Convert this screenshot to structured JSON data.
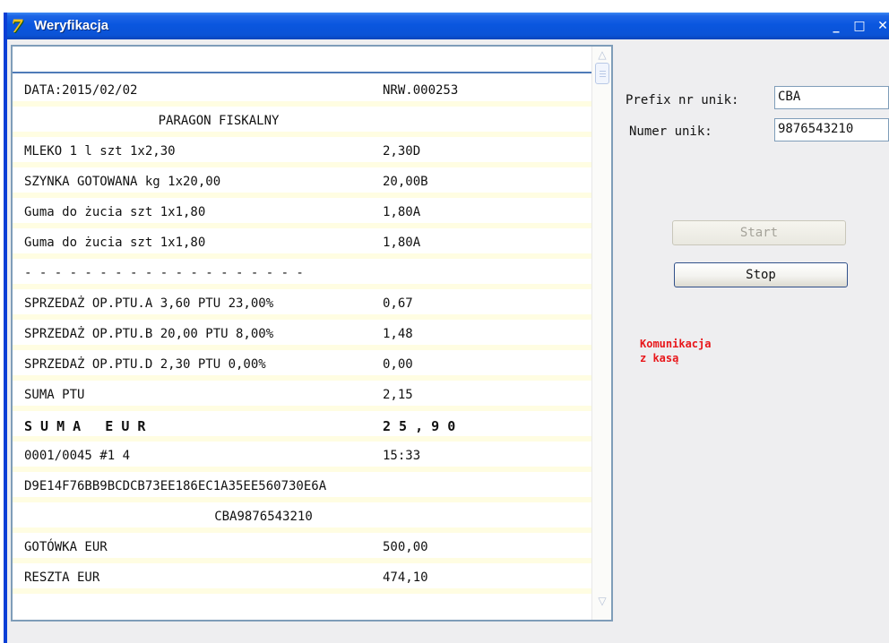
{
  "window": {
    "title": "Weryfikacja",
    "icon": "7"
  },
  "controls": {
    "minimize": "_",
    "maximize": "□",
    "close": "✕"
  },
  "receipt": {
    "lines": [
      {
        "left": "DATA:2015/02/02",
        "right": "NRW.000253"
      },
      {
        "center": "PARAGON FISKALNY"
      },
      {
        "left": "MLEKO 1 l szt 1x2,30",
        "right": "2,30D"
      },
      {
        "left": "SZYNKA GOTOWANA kg 1x20,00",
        "right": "20,00B"
      },
      {
        "left": "Guma do żucia szt 1x1,80",
        "right": "1,80A"
      },
      {
        "left": "Guma do żucia szt 1x1,80",
        "right": "1,80A"
      },
      {
        "left": "- - - - - - - - - - - - - - - - - - -"
      },
      {
        "left": "SPRZEDAŻ OP.PTU.A 3,60 PTU 23,00%",
        "right": "0,67"
      },
      {
        "left": "SPRZEDAŻ OP.PTU.B 20,00 PTU 8,00%",
        "right": "1,48"
      },
      {
        "left": "SPRZEDAŻ OP.PTU.D 2,30 PTU 0,00%",
        "right": "0,00"
      },
      {
        "left": "SUMA PTU",
        "right": "2,15"
      },
      {
        "left": "S U M A   E U R",
        "right": "2 5 , 9 0",
        "bold": true
      },
      {
        "left": "0001/0045 #1 4",
        "right": "15:33"
      },
      {
        "left": "D9E14F76BB9BCDCB73EE186EC1A35EE560730E6A"
      },
      {
        "center": "CBA9876543210"
      },
      {
        "left": "GOTÓWKA EUR",
        "right": "500,00"
      },
      {
        "left": "RESZTA EUR",
        "right": "474,10"
      }
    ]
  },
  "form": {
    "prefix_label": "Prefix nr unik:",
    "prefix_value": "CBA",
    "number_label": "Numer unik:",
    "number_value": "9876543210"
  },
  "buttons": {
    "start": "Start",
    "stop": "Stop"
  },
  "status": {
    "line1": "Komunikacja",
    "line2": "z kasą",
    "color": "#e8171b"
  },
  "colors": {
    "titlebar": "#0a56df",
    "row_separator": "#fffde2"
  }
}
